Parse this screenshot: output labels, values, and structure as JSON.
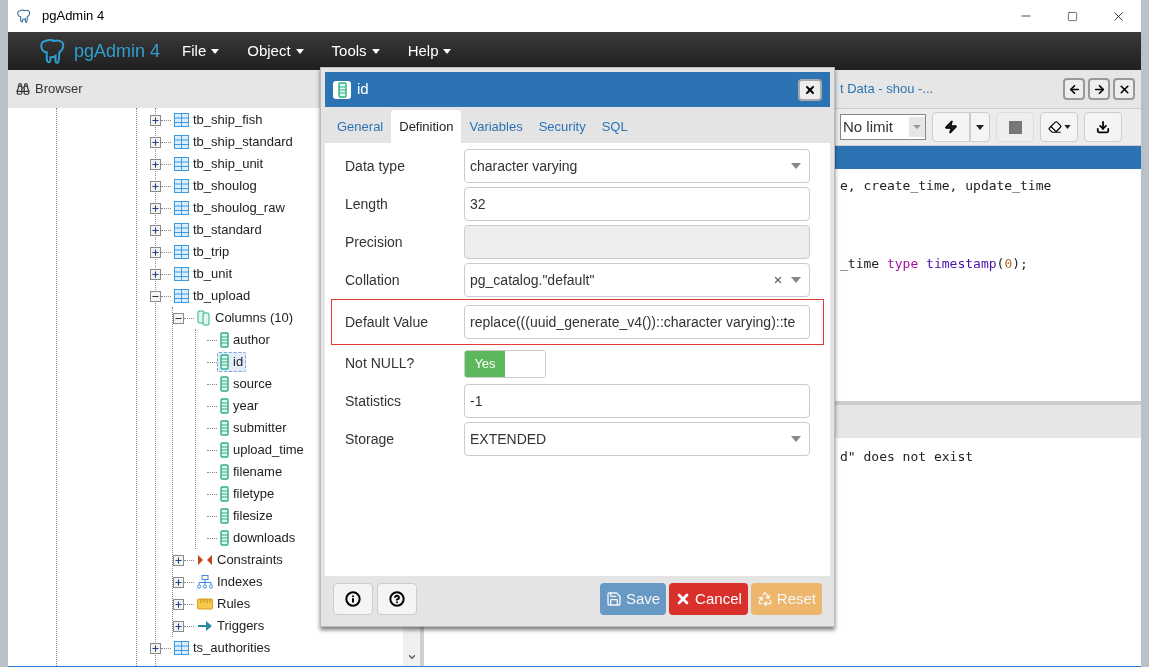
{
  "window": {
    "title": "pgAdmin 4"
  },
  "menubar": {
    "brand": "pgAdmin 4",
    "menus": [
      "File",
      "Object",
      "Tools",
      "Help"
    ]
  },
  "browser": {
    "title": "Browser",
    "tree": [
      {
        "label": "tb_ship_fish",
        "kind": "table",
        "expanded": false,
        "selected": false
      },
      {
        "label": "tb_ship_standard",
        "kind": "table",
        "expanded": false,
        "selected": false
      },
      {
        "label": "tb_ship_unit",
        "kind": "table",
        "expanded": false,
        "selected": false
      },
      {
        "label": "tb_shoulog",
        "kind": "table",
        "expanded": false,
        "selected": false
      },
      {
        "label": "tb_shoulog_raw",
        "kind": "table",
        "expanded": false,
        "selected": false
      },
      {
        "label": "tb_standard",
        "kind": "table",
        "expanded": false,
        "selected": false
      },
      {
        "label": "tb_trip",
        "kind": "table",
        "expanded": false,
        "selected": false
      },
      {
        "label": "tb_unit",
        "kind": "table",
        "expanded": false,
        "selected": false
      },
      {
        "label": "tb_upload",
        "kind": "table",
        "expanded": true,
        "selected": false,
        "children": [
          {
            "label": "Columns (10)",
            "kind": "columns",
            "expanded": true,
            "selected": false,
            "children": [
              {
                "label": "author",
                "kind": "column",
                "selected": false
              },
              {
                "label": "id",
                "kind": "column",
                "selected": true
              },
              {
                "label": "source",
                "kind": "column",
                "selected": false
              },
              {
                "label": "year",
                "kind": "column",
                "selected": false
              },
              {
                "label": "submitter",
                "kind": "column",
                "selected": false
              },
              {
                "label": "upload_time",
                "kind": "column",
                "selected": false
              },
              {
                "label": "filename",
                "kind": "column",
                "selected": false
              },
              {
                "label": "filetype",
                "kind": "column",
                "selected": false
              },
              {
                "label": "filesize",
                "kind": "column",
                "selected": false
              },
              {
                "label": "downloads",
                "kind": "column",
                "selected": false
              }
            ]
          },
          {
            "label": "Constraints",
            "kind": "constraints",
            "expanded": false,
            "selected": false
          },
          {
            "label": "Indexes",
            "kind": "indexes",
            "expanded": false,
            "selected": false
          },
          {
            "label": "Rules",
            "kind": "rules",
            "expanded": false,
            "selected": false
          },
          {
            "label": "Triggers",
            "kind": "triggers",
            "expanded": false,
            "selected": false
          }
        ]
      },
      {
        "label": "ts_authorities",
        "kind": "table",
        "expanded": false,
        "selected": false
      }
    ]
  },
  "query_tool": {
    "tab_title": "t Data - shou -...",
    "limit": "No limit",
    "code_lines": [
      [
        {
          "text": "e, create_time, update_time",
          "kind": "plain"
        }
      ],
      [
        {
          "text": "_time ",
          "kind": "plain"
        },
        {
          "text": "type",
          "kind": "keyword"
        },
        {
          "text": " timestamp",
          "kind": "builtin"
        },
        {
          "text": "(",
          "kind": "plain"
        },
        {
          "text": "0",
          "kind": "number"
        },
        {
          "text": ");",
          "kind": "plain"
        }
      ]
    ],
    "message": "d\" does not exist"
  },
  "dialog": {
    "title": "id",
    "tabs": [
      {
        "label": "General",
        "selected": false
      },
      {
        "label": "Definition",
        "selected": true
      },
      {
        "label": "Variables",
        "selected": false
      },
      {
        "label": "Security",
        "selected": false
      },
      {
        "label": "SQL",
        "selected": false
      }
    ],
    "fields": [
      {
        "label": "Data type",
        "kind": "select",
        "value": "character varying",
        "highlighted": false
      },
      {
        "label": "Length",
        "kind": "input",
        "value": "32",
        "highlighted": false
      },
      {
        "label": "Precision",
        "kind": "disabled",
        "highlighted": false
      },
      {
        "label": "Collation",
        "kind": "clearable",
        "value": "pg_catalog.\"default\"",
        "highlighted": false
      },
      {
        "label": "Default Value",
        "kind": "input",
        "value": "replace(((uuid_generate_v4())::character varying)::te",
        "highlighted": true
      },
      {
        "label": "Not NULL?",
        "kind": "switch",
        "value": "Yes",
        "on": true,
        "highlighted": false
      },
      {
        "label": "Statistics",
        "kind": "input",
        "value": "-1",
        "highlighted": false
      },
      {
        "label": "Storage",
        "kind": "select",
        "value": "EXTENDED",
        "highlighted": false
      }
    ],
    "buttons": [
      {
        "label": "Save",
        "kind": "save",
        "disabled": true
      },
      {
        "label": "Cancel",
        "kind": "cancel",
        "disabled": false
      },
      {
        "label": "Reset",
        "kind": "reset",
        "disabled": true
      }
    ]
  }
}
